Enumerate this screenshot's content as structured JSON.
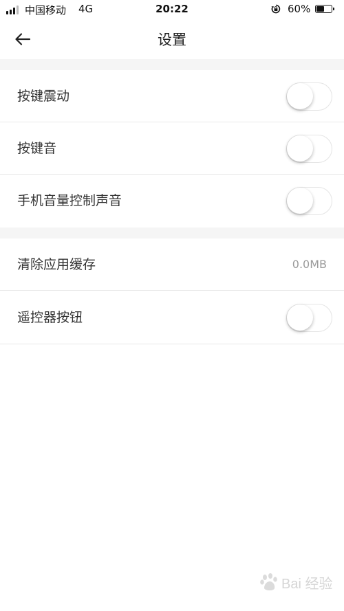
{
  "status_bar": {
    "carrier": "中国移动",
    "network": "4G",
    "time": "20:22",
    "battery_percent": "60%",
    "battery_level": 0.6,
    "icons": [
      "signal-icon",
      "rotation-lock-icon",
      "battery-icon"
    ]
  },
  "nav": {
    "title": "设置",
    "back_icon": "back-arrow-icon"
  },
  "settings": [
    {
      "label": "按键震动",
      "type": "toggle",
      "on": false
    },
    {
      "label": "按键音",
      "type": "toggle",
      "on": false
    },
    {
      "label": "手机音量控制声音",
      "type": "toggle",
      "on": false
    },
    {
      "label": "清除应用缓存",
      "type": "value",
      "value": "0.0MB"
    },
    {
      "label": "遥控器按钮",
      "type": "toggle",
      "on": false
    }
  ],
  "watermark": {
    "text": "Bai 经验"
  },
  "colors": {
    "background": "#ffffff",
    "section_gap": "#f5f5f5",
    "divider": "#e8e8e8",
    "label": "#333333",
    "secondary_value": "#9a9a9a",
    "toggle_border": "#e4e4e4"
  }
}
